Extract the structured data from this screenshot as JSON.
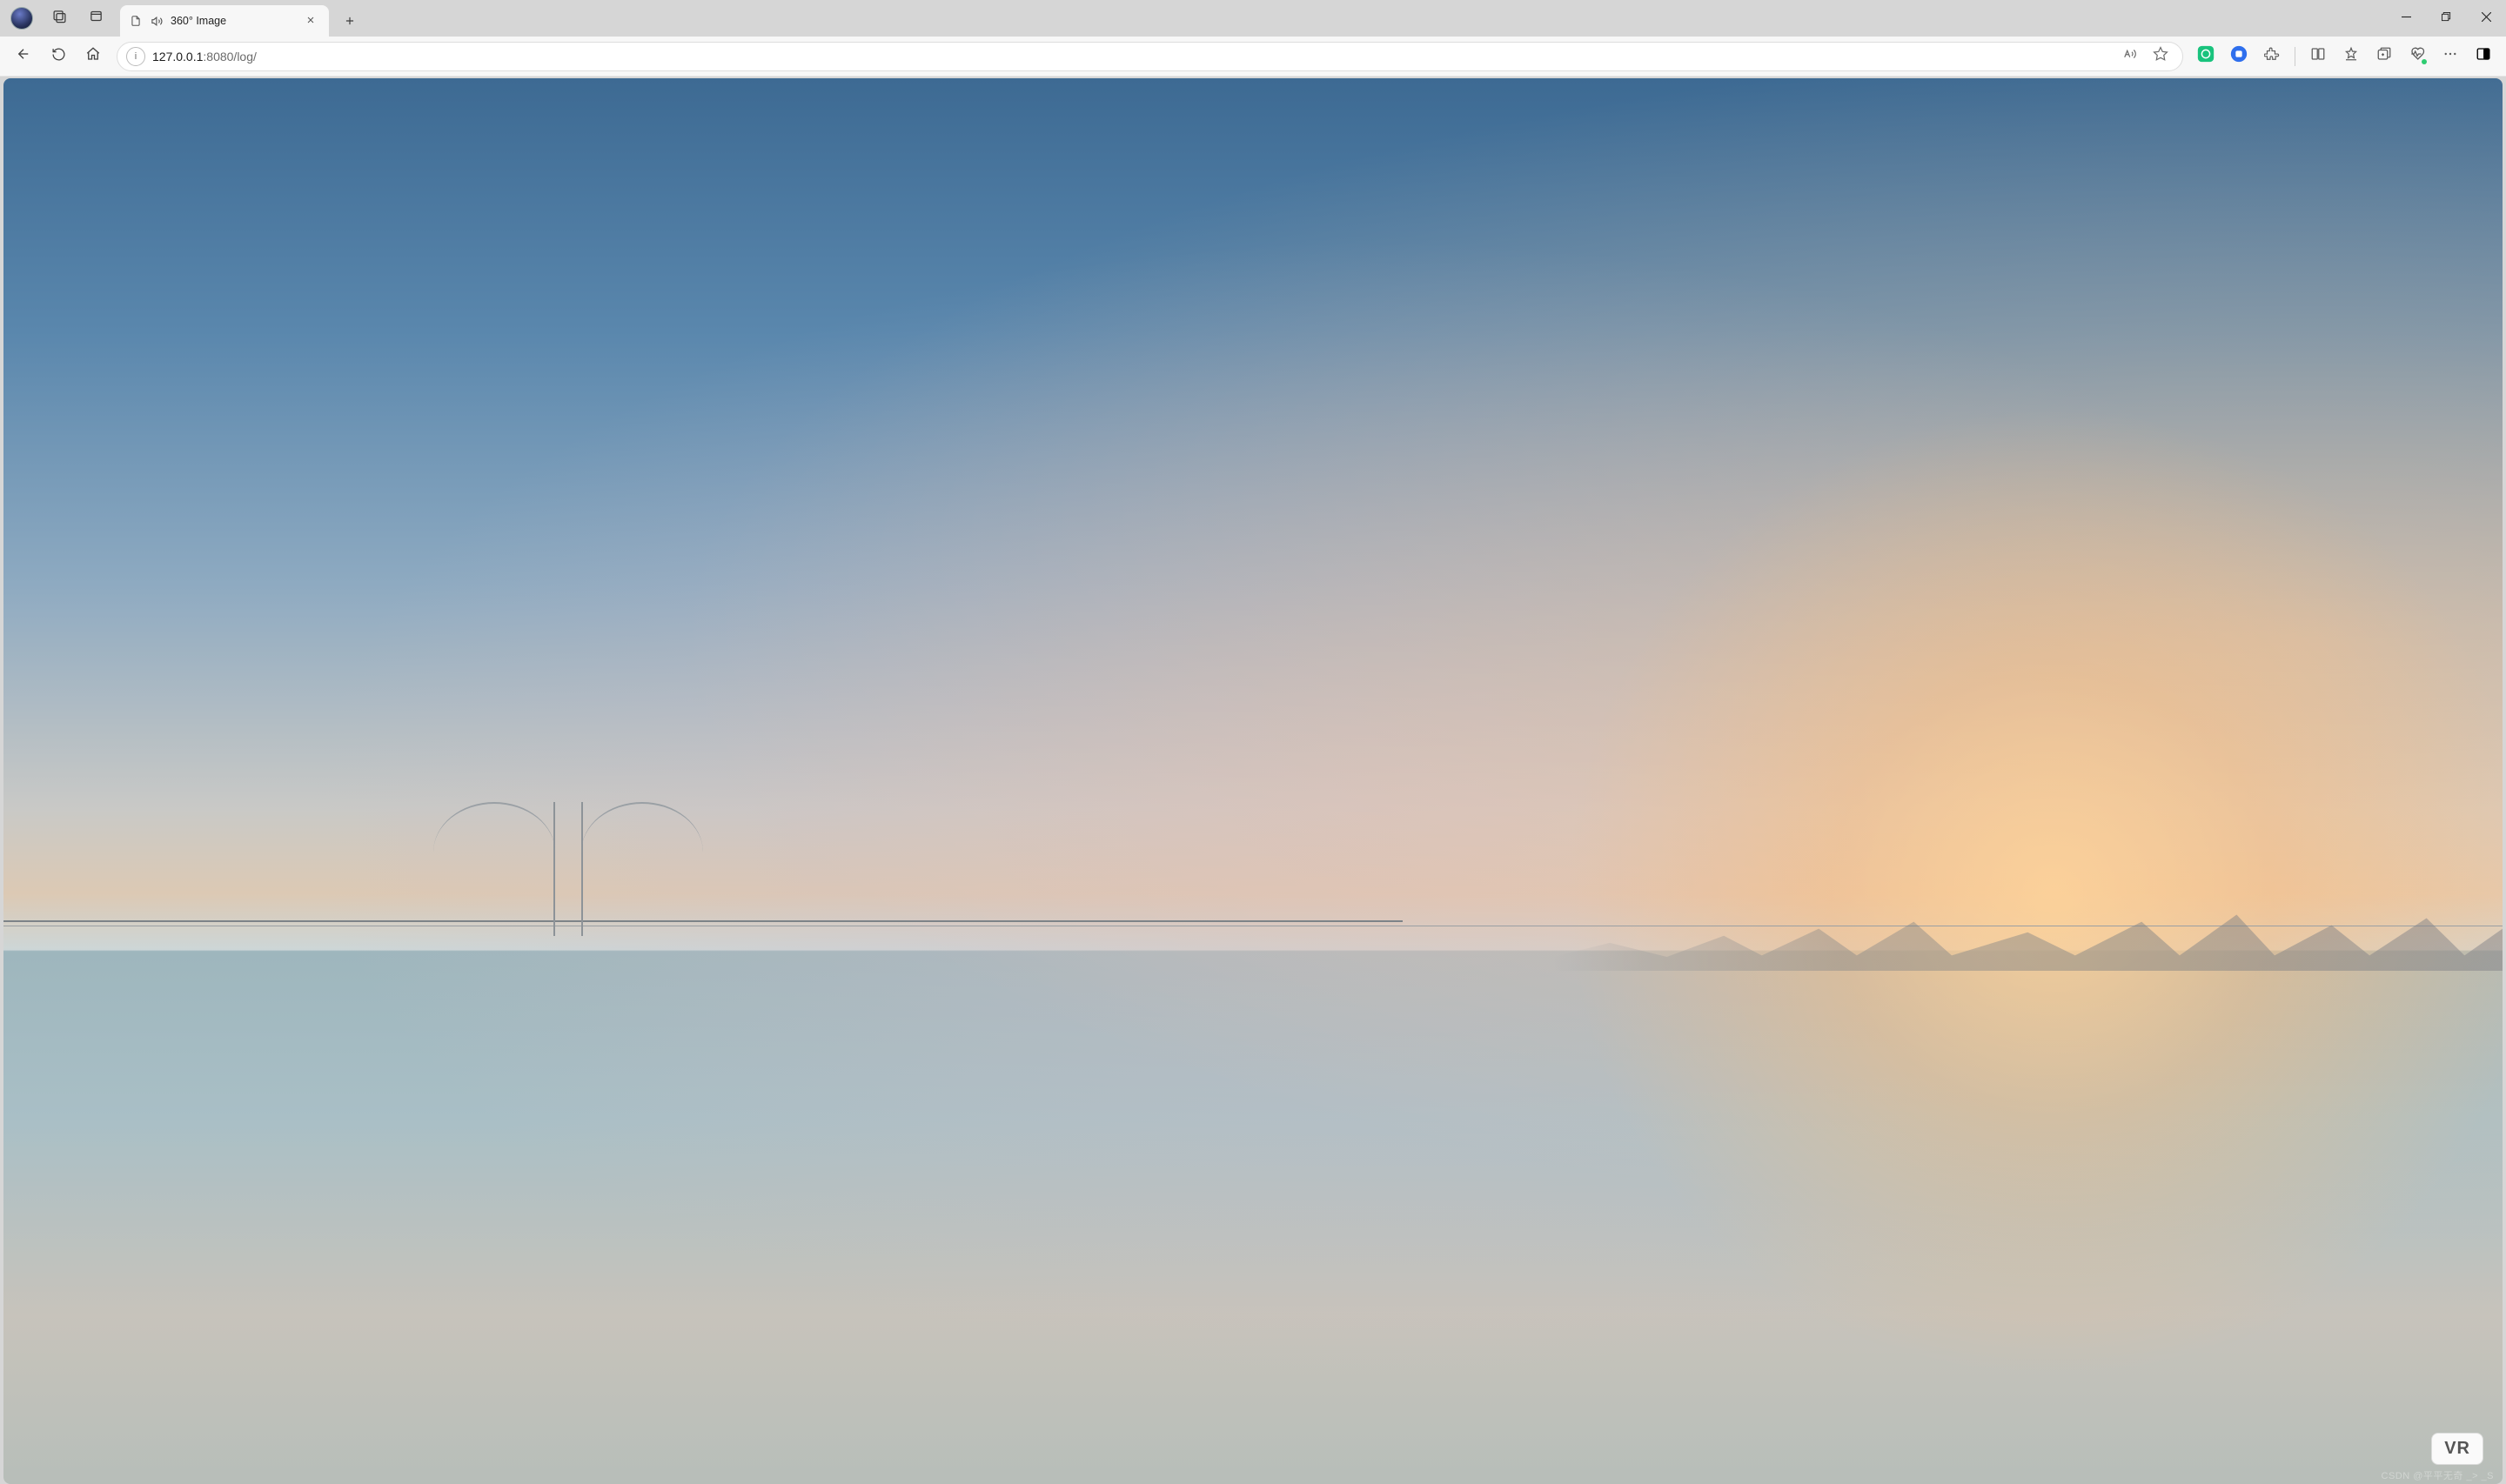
{
  "tab": {
    "title": "360° Image",
    "page_icon": "document-icon",
    "mute_icon": "audio-icon"
  },
  "address": {
    "host": "127.0.0.1",
    "port_path": ":8080/log/"
  },
  "viewer": {
    "vr_button_label": "VR",
    "watermark": "CSDN @平平无奇 _> _S"
  },
  "icons": {
    "workspaces": "workspaces-icon",
    "tab_actions": "tab-actions-icon",
    "file": "file-icon",
    "audio": "audio-icon",
    "close_tab": "close-icon",
    "new_tab": "plus-icon",
    "minimize": "minimize-icon",
    "maximize": "maximize-icon",
    "close_window": "close-window-icon",
    "back": "back-icon",
    "forward": "forward-icon",
    "refresh": "refresh-icon",
    "home": "home-icon",
    "site_info": "info-icon",
    "read_aloud": "read-aloud-icon",
    "favorite": "star-icon",
    "ext_chatgpt": "chatgpt-ext-icon",
    "ext_blue": "container-ext-icon",
    "extensions": "extensions-icon",
    "split_screen": "split-screen-icon",
    "favorites_list": "favorites-bar-icon",
    "collections": "collections-icon",
    "browser_essentials": "heart-pulse-icon",
    "more": "more-icon",
    "sidebar": "sidebar-toggle-icon"
  }
}
